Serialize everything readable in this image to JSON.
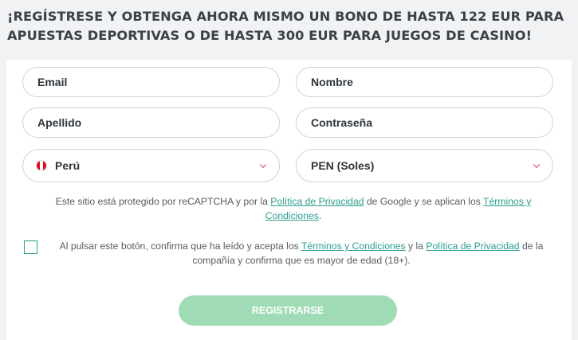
{
  "headline": {
    "line1": "¡REGÍSTRESE Y OBTENGA AHORA MISMO UN BONO DE HASTA 122 EUR PARA",
    "line2": "APUESTAS DEPORTIVAS O DE HASTA 300 EUR PARA JUEGOS DE CASINO!"
  },
  "form": {
    "email_placeholder": "Email",
    "name_placeholder": "Nombre",
    "surname_placeholder": "Apellido",
    "password_placeholder": "Contraseña",
    "country_value": "Perú",
    "currency_value": "PEN (Soles)"
  },
  "recaptcha": {
    "text1": "Este sitio está protegido por reCAPTCHA y por la ",
    "privacy_link": "Política de Privacidad",
    "text2": " de Google y se aplican los ",
    "terms_link": "Términos y Condiciones",
    "text3": "."
  },
  "consent": {
    "text1": "Al pulsar este botón, confirma que ha leído y acepta los ",
    "terms_link": "Términos y Condiciones",
    "text2": " y la ",
    "privacy_link": "Política de Privacidad",
    "text3": " de la compañía y confirma que es mayor de edad (18+).",
    "checked": false
  },
  "register_label": "REGISTRARSE",
  "colors": {
    "accent": "#2a9d90",
    "button": "#9fdcb6",
    "chevron": "#d32f4d",
    "background": "#f1f2f4"
  }
}
